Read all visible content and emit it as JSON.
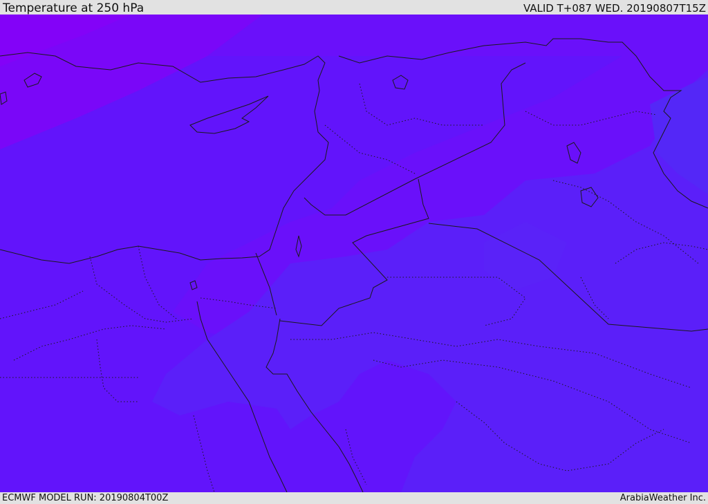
{
  "header": {
    "title": "Temperature at 250 hPa",
    "valid": "VALID T+087 WED. 20190807T15Z"
  },
  "footer": {
    "model_run": "ECMWF MODEL RUN: 20190804T00Z",
    "credit": "ArabiaWeather Inc."
  },
  "colors": {
    "warm_band": "#8302f8",
    "band_violet": "#6d0ff9",
    "band_indigo": "#6214fb",
    "band_blue": "#5b1ff9",
    "band_light_blue": "#5427f7",
    "coast_line": "#1a1a1a"
  }
}
